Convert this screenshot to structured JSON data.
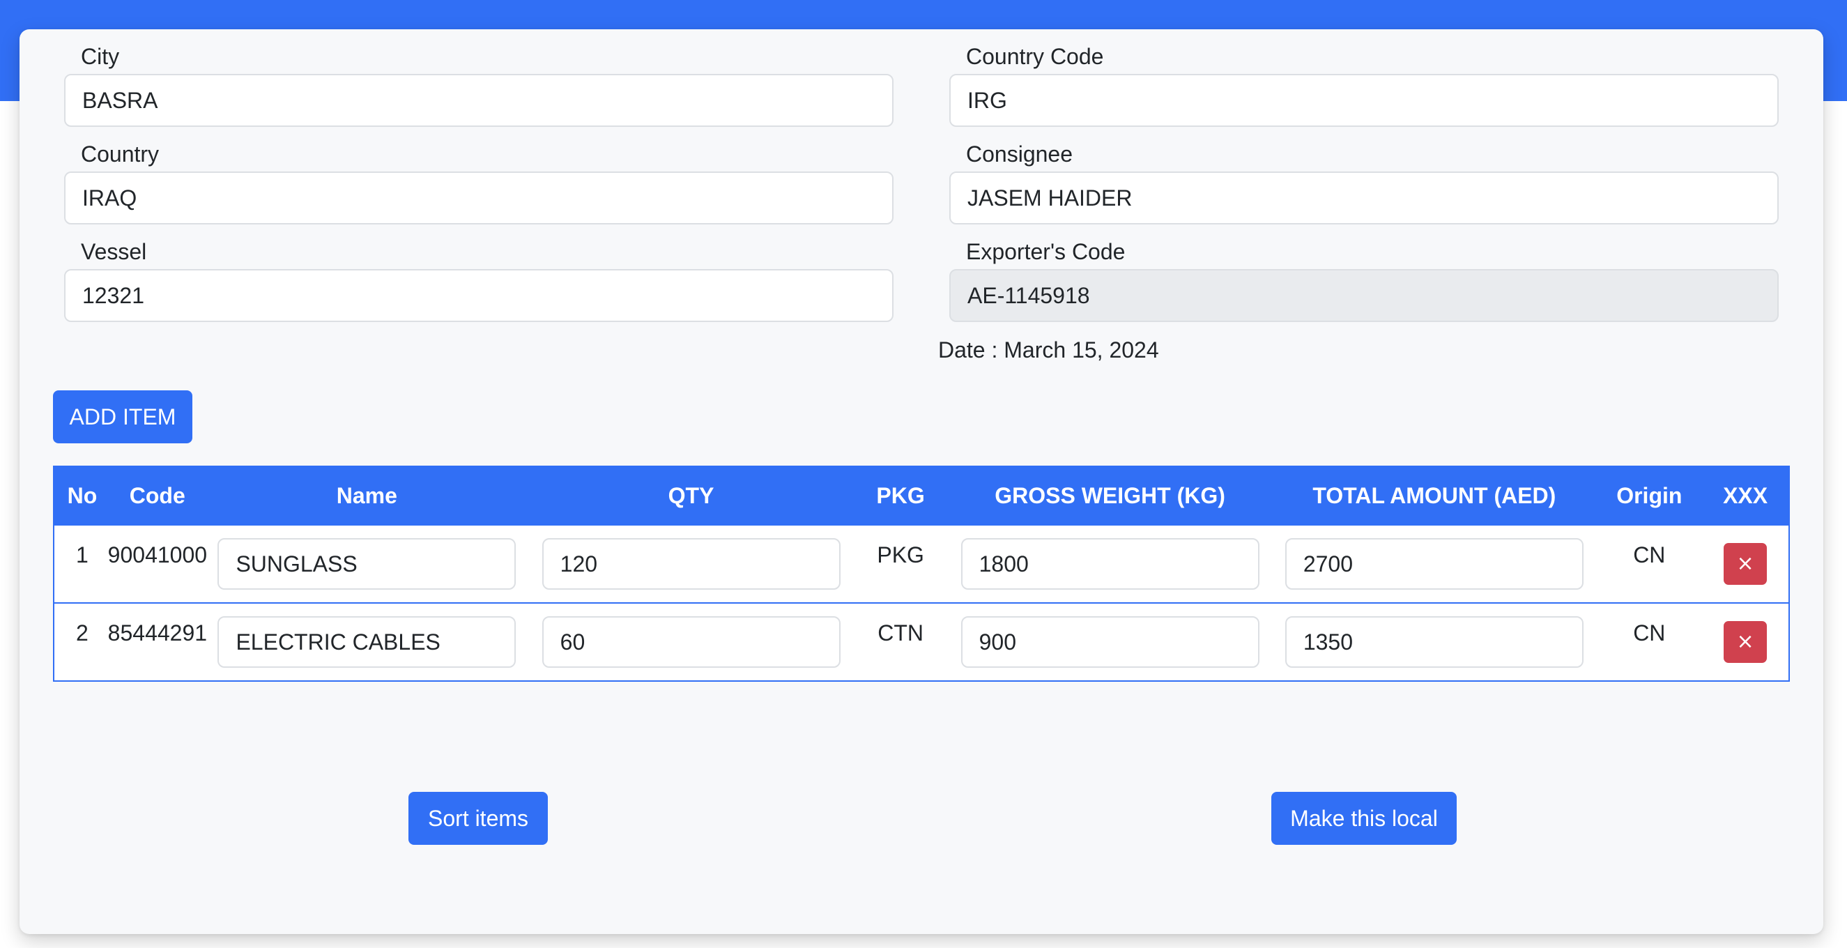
{
  "form": {
    "city": {
      "label": "City",
      "value": "BASRA"
    },
    "country_code": {
      "label": "Country Code",
      "value": "IRG"
    },
    "country": {
      "label": "Country",
      "value": "IRAQ"
    },
    "consignee": {
      "label": "Consignee",
      "value": "JASEM HAIDER"
    },
    "vessel": {
      "label": "Vessel",
      "value": "12321"
    },
    "exporter_code": {
      "label": "Exporter's Code",
      "value": "AE-1145918"
    }
  },
  "date_text": "Date : March 15, 2024",
  "add_item_label": "ADD ITEM",
  "table": {
    "headers": [
      "No",
      "Code",
      "Name",
      "QTY",
      "PKG",
      "GROSS WEIGHT (KG)",
      "TOTAL AMOUNT (AED)",
      "Origin",
      "XXX"
    ],
    "rows": [
      {
        "no": "1",
        "code": "90041000",
        "name": "SUNGLASS",
        "qty": "120",
        "pkg": "PKG",
        "gross_weight": "1800",
        "total_amount": "2700",
        "origin": "CN",
        "delete_label": "×"
      },
      {
        "no": "2",
        "code": "85444291",
        "name": "ELECTRIC CABLES",
        "qty": "60",
        "pkg": "CTN",
        "gross_weight": "900",
        "total_amount": "1350",
        "origin": "CN",
        "delete_label": "×"
      }
    ]
  },
  "sort_label": "Sort items",
  "local_label": "Make this local",
  "colors": {
    "accent": "#316ff5",
    "danger": "#d0414e",
    "card_bg": "#f7f8fa"
  }
}
